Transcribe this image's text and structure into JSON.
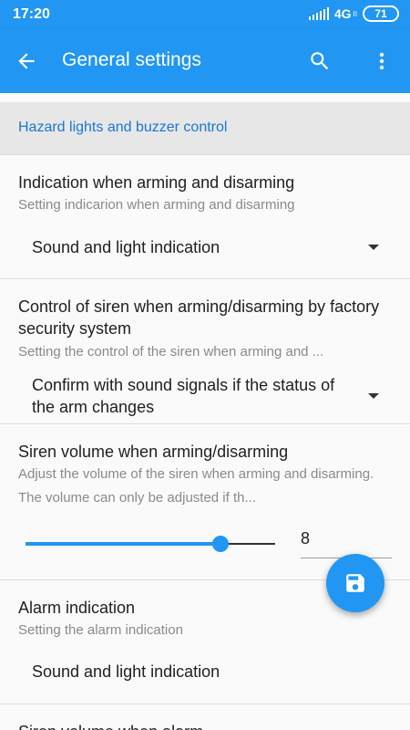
{
  "status_bar": {
    "time": "17:20",
    "network": "4G",
    "network_sub": "II",
    "battery": "71"
  },
  "app_bar": {
    "back_icon": "arrow-left-icon",
    "title": "General settings",
    "search_icon": "search-icon",
    "more_icon": "more-vertical-icon"
  },
  "section": {
    "title": "Hazard lights and buzzer control"
  },
  "items": [
    {
      "title": "Indication when arming and disarming",
      "subtitle": "Setting indicarion when arming and disarming",
      "value": "Sound and light indication"
    },
    {
      "title": "Control of siren when arming/disarming by factory security system",
      "subtitle": "Setting the control of the siren when arming and ...",
      "value": "Confirm with sound signals if the status of the arm changes"
    },
    {
      "title": "Siren volume when arming/disarming",
      "subtitle": "Adjust the volume of the siren when arming and disarming. The volume can only be adjusted if th...",
      "volume_value": "8",
      "slider_fraction": 0.78
    },
    {
      "title": "Alarm indication",
      "subtitle": "Setting the alarm indication",
      "value": "Sound and light indication"
    },
    {
      "title": "Siren volume when alarm"
    }
  ],
  "fab": {
    "icon": "save-icon"
  },
  "colors": {
    "primary": "#2196f3",
    "accent_text": "#1976d2"
  }
}
